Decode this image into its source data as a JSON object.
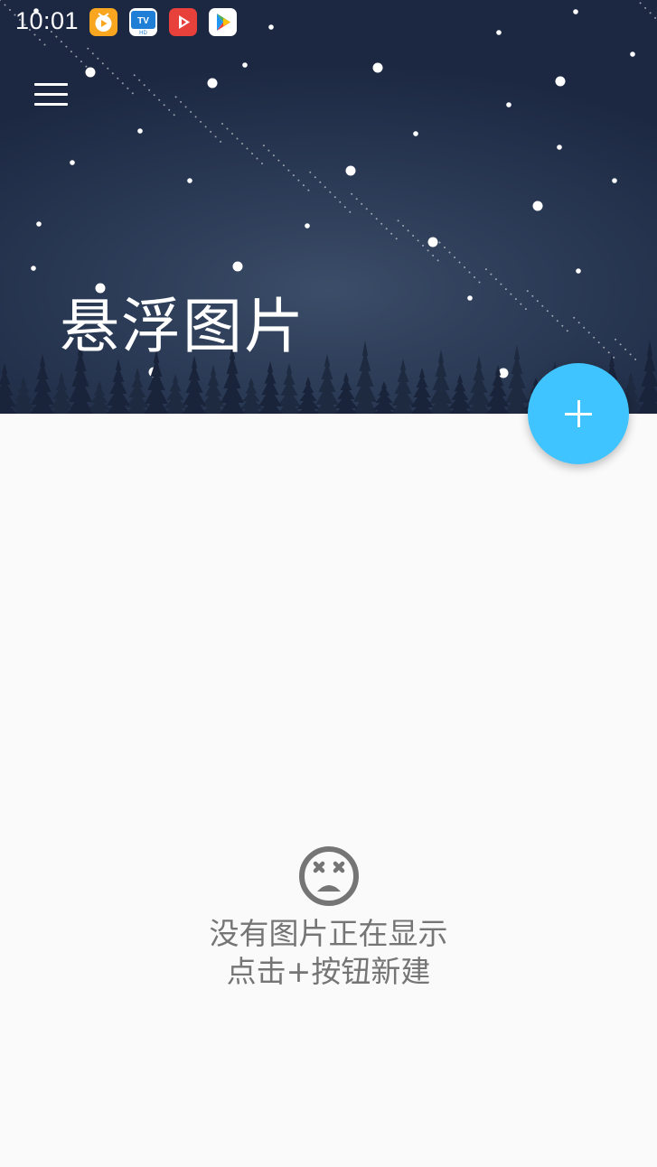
{
  "status_bar": {
    "time": "10:01",
    "apps": [
      {
        "icon": "tv-app-orange-icon",
        "color": "#f8a51f"
      },
      {
        "icon": "tv-hd-app-icon",
        "color": "#1f7fd6"
      },
      {
        "icon": "video-app-red-icon",
        "color": "#e8413c"
      },
      {
        "icon": "play-store-icon",
        "color": "#ffffff"
      }
    ]
  },
  "header": {
    "menu_icon": "hamburger-menu-icon",
    "title": "悬浮图片",
    "background": "night-sky-forest"
  },
  "fab": {
    "icon": "plus-icon",
    "color": "#40c4ff"
  },
  "empty_state": {
    "icon": "sad-face-icon",
    "line1": "没有图片正在显示",
    "line2": "点击+按钮新建"
  }
}
